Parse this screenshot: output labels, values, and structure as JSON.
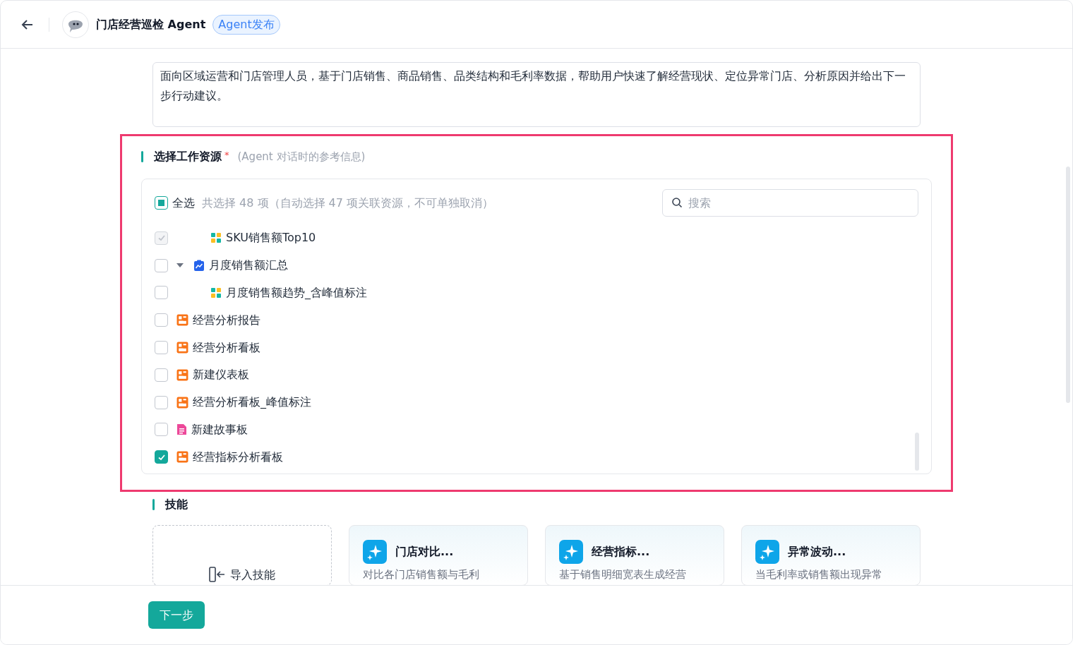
{
  "header": {
    "title": "门店经营巡检 Agent",
    "badge": "Agent发布"
  },
  "description": {
    "value": "面向区域运营和门店管理人员，基于门店销售、商品销售、品类结构和毛利率数据，帮助用户快速了解经营现状、定位异常门店、分析原因并给出下一步行动建议。"
  },
  "resources": {
    "highlighted": true,
    "title": "选择工作资源",
    "required": "*",
    "hint": "(Agent 对话时的参考信息)",
    "select_all": {
      "label": "全选",
      "partial": true
    },
    "summary": "共选择 48 项（自动选择 47 项关联资源，不可单独取消）",
    "search": {
      "placeholder": "搜索"
    },
    "tree": [
      {
        "children": [
          {
            "children": [
              {
                "kind": "chart",
                "label": "SKU销售额Top10",
                "checked": true,
                "disabled": true
              }
            ]
          },
          {
            "kind": "metric",
            "label": "月度销售额汇总",
            "checked": false,
            "disabled": false,
            "expanded": true,
            "children": [
              {
                "kind": "chart",
                "label": "月度销售额趋势_含峰值标注",
                "checked": false,
                "disabled": false
              }
            ]
          }
        ]
      },
      {
        "kind": "dashboard",
        "label": "经营分析报告",
        "checked": false,
        "disabled": false
      },
      {
        "kind": "dashboard",
        "label": "经营分析看板",
        "checked": false,
        "disabled": false
      },
      {
        "kind": "dashboard",
        "label": "新建仪表板",
        "checked": false,
        "disabled": false
      },
      {
        "kind": "dashboard",
        "label": "经营分析看板_峰值标注",
        "checked": false,
        "disabled": false
      },
      {
        "kind": "story",
        "label": "新建故事板",
        "checked": false,
        "disabled": false
      },
      {
        "kind": "dashboard",
        "label": "经营指标分析看板",
        "checked": true,
        "disabled": false
      }
    ]
  },
  "skills": {
    "title": "技能",
    "import_label": "导入技能",
    "cards": [
      {
        "title": "门店对比...",
        "description": "对比各门店销售额与毛利"
      },
      {
        "title": "经营指标...",
        "description": "基于销售明细宽表生成经营"
      },
      {
        "title": "异常波动...",
        "description": "当毛利率或销售额出现异常"
      }
    ]
  },
  "footer": {
    "next_button": "下一步"
  }
}
